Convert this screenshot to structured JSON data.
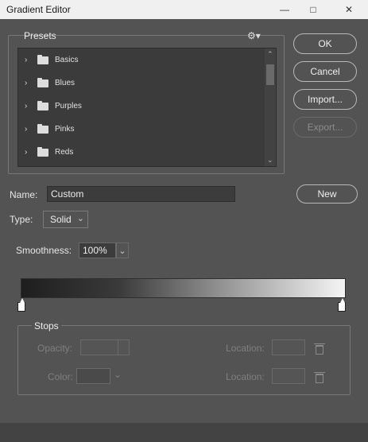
{
  "window": {
    "title": "Gradient Editor"
  },
  "presets": {
    "label": "Presets",
    "items": [
      {
        "label": "Basics"
      },
      {
        "label": "Blues"
      },
      {
        "label": "Purples"
      },
      {
        "label": "Pinks"
      },
      {
        "label": "Reds"
      }
    ]
  },
  "actions": {
    "ok": "OK",
    "cancel": "Cancel",
    "import": "Import...",
    "export": "Export..."
  },
  "name": {
    "label": "Name:",
    "value": "Custom",
    "new_button": "New"
  },
  "type": {
    "label": "Type:",
    "value": "Solid"
  },
  "smoothness": {
    "label": "Smoothness:",
    "value": "100%"
  },
  "stops": {
    "label": "Stops",
    "opacity_label": "Opacity:",
    "location_label": "Location:",
    "color_label": "Color:",
    "location_label_2": "Location:"
  },
  "icons": {
    "gear": "gear-icon",
    "chevron": "chevron-right-icon",
    "folder": "folder-icon",
    "trash": "trash-icon"
  }
}
